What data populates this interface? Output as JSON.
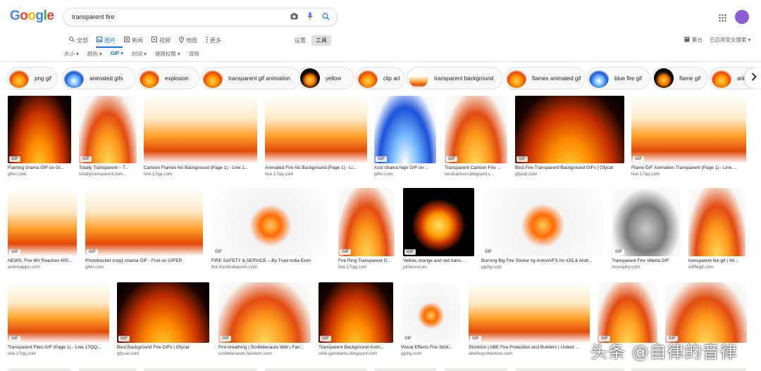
{
  "logo": {
    "letters": [
      "G",
      "o",
      "o",
      "g",
      "l",
      "e"
    ],
    "colors": [
      "#4285f4",
      "#ea4335",
      "#fbbc05",
      "#4285f4",
      "#34a853",
      "#ea4335"
    ]
  },
  "search": {
    "query": "transparent fire"
  },
  "tabs": [
    {
      "label": "全部",
      "icon": "search-icon"
    },
    {
      "label": "图片",
      "icon": "image-icon",
      "active": true
    },
    {
      "label": "新闻",
      "icon": "news-icon"
    },
    {
      "label": "视频",
      "icon": "video-icon"
    },
    {
      "label": "地图",
      "icon": "map-pin-icon"
    },
    {
      "label": "更多",
      "icon": "more-icon"
    }
  ],
  "settings": {
    "settings_label": "设置",
    "tools_label": "工具"
  },
  "right_links": {
    "collections_label": "集合",
    "safesearch_label": "已启用安全搜索"
  },
  "filters": [
    {
      "label": "大小"
    },
    {
      "label": "颜色"
    },
    {
      "label": "GIF",
      "active": true
    },
    {
      "label": "时间"
    },
    {
      "label": "使用权限"
    },
    {
      "label": "清除"
    }
  ],
  "chips": [
    {
      "label": "png gif",
      "thumb": "orange"
    },
    {
      "label": "animated gifs",
      "thumb": "blue"
    },
    {
      "label": "explosion",
      "thumb": "orange"
    },
    {
      "label": "transparent gif animation",
      "thumb": "orange"
    },
    {
      "label": "yellow",
      "thumb": "dark"
    },
    {
      "label": "clip art",
      "thumb": "orange"
    },
    {
      "label": "transparent background",
      "thumb": "band"
    },
    {
      "label": "flames animated gif",
      "thumb": "orange"
    },
    {
      "label": "blue fire gif",
      "thumb": "blue"
    },
    {
      "label": "flame gif",
      "thumb": "dark"
    },
    {
      "label": "ani",
      "thumb": "orange"
    }
  ],
  "results": [
    {
      "caption": "Flaming chama GIF on Gi...",
      "source": "gifer.com",
      "badge": "GIF",
      "style": "dark"
    },
    {
      "caption": "Totally Transparent – T...",
      "source": "totallytransparent.tum...",
      "badge": "GIF",
      "style": "light"
    },
    {
      "caption": "Cartoon Flames No Background (Page 1) - Line.1...",
      "source": "line.17qq.com",
      "badge": "",
      "style": "band"
    },
    {
      "caption": "Animated Fire No Background (Page 1) - Li...",
      "source": "line.17qq.com",
      "badge": "",
      "style": "band"
    },
    {
      "caption": "Azul chama fogo GIF on ...",
      "source": "gifer.com",
      "badge": "GIF",
      "style": "blue"
    },
    {
      "caption": "Transparent Cartoon Fire ...",
      "source": "bestcartoon.blogspot.c...",
      "badge": "GIF",
      "style": "light"
    },
    {
      "caption": "Best Fire Transparent Background GIFs | Gfycat",
      "source": "gfycat.com",
      "badge": "GIF",
      "style": "dark"
    },
    {
      "caption": "Flame GIF Animation Transparent (Page 1) - Line....",
      "source": "line.17qq.com",
      "badge": "GIF",
      "style": "band"
    },
    {
      "caption": "NEWS: Fire MV Reaches 600...",
      "source": "aminoapps.com",
      "badge": "GIF",
      "style": "band"
    },
    {
      "caption": "Photobucket zorq1 chama GIF - Find on GIFER",
      "source": "gifer.com",
      "badge": "GIF",
      "style": "band"
    },
    {
      "caption": "FIRE SAFETY & SERVICE – By Trust India Exim",
      "source": "fire.frustindiaexim.com",
      "badge": "GIF",
      "style": "small"
    },
    {
      "caption": "Fire Ring Transparent G...",
      "source": "line.17qq.com",
      "badge": "GIF",
      "style": "light"
    },
    {
      "caption": "Yellow, orange and red trans...",
      "source": "pinterest.es",
      "badge": "GIF",
      "style": "emblem"
    },
    {
      "caption": "Burning Big Fire Sticker by ActionVFX for iOS & Andr...",
      "source": "giphy.com",
      "badge": "GIF",
      "style": "small"
    },
    {
      "caption": "Transparent Fire Villetta GIF",
      "source": "monophy.com",
      "badge": "GIF",
      "style": "grey"
    },
    {
      "caption": "transparent fire gif | Wi...",
      "source": "wifflegif.com",
      "badge": "",
      "style": "light"
    },
    {
      "caption": "Transparent Flies GIF (Page 1) - Line.17QQ...",
      "source": "line.17qq.com",
      "badge": "GIF",
      "style": "band"
    },
    {
      "caption": "Best Background Fire GIFs | Gfycat",
      "source": "gfycat.com",
      "badge": "GIF",
      "style": "dark"
    },
    {
      "caption": "Fire-breathing | Scribblenauts Wiki | Fan...",
      "source": "scribblenauts.fandom.com",
      "badge": "GIF",
      "style": "light"
    },
    {
      "caption": "Transparent Background Anim...",
      "source": "stok-gambarku.blogspot.com",
      "badge": "GIF",
      "style": "dark"
    },
    {
      "caption": "Visual Effects Fire Stick...",
      "source": "giphy.com",
      "badge": "GIF",
      "style": "small"
    },
    {
      "caption": "Stockton | ABE Fire Protection and Builders | United ...",
      "source": "abefireprotection.com",
      "badge": "GIF",
      "style": "band"
    },
    {
      "caption": "",
      "source": "",
      "badge": "GIF",
      "style": "light"
    },
    {
      "caption": "",
      "source": "",
      "badge": "GIF",
      "style": "light"
    }
  ],
  "watermark": "头条 @自律的音律"
}
